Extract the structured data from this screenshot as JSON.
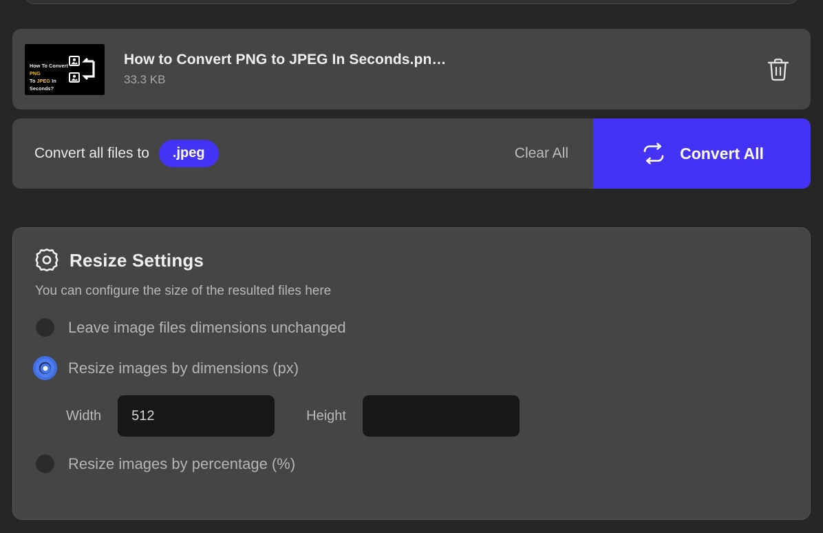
{
  "theme": {
    "page_bg": "#262626",
    "card_bg": "#454545",
    "accent": "#4433f5",
    "radio_accent": "#4472e8",
    "input_bg": "#171717"
  },
  "file_row": {
    "thumbnail": {
      "line1_prefix": "How To Convert ",
      "line1_highlight": "PNG",
      "line2_prefix": "To ",
      "line2_highlight": "JPEG",
      "line2_suffix": " In Seconds?",
      "icon": "image-swap-icon",
      "background": "#000000"
    },
    "name": "How to Convert PNG to JPEG In Seconds.pn…",
    "size": "33.3 KB",
    "delete_icon": "trash-icon"
  },
  "convert_bar": {
    "label": "Convert all files to",
    "format": ".jpeg",
    "clear_all": "Clear All",
    "convert_all": "Convert All",
    "convert_icon": "cycle-arrows-icon"
  },
  "resize_settings": {
    "icon": "gear-icon",
    "title": "Resize Settings",
    "subtitle": "You can configure the size of the resulted files here",
    "options": [
      {
        "label": "Leave image files dimensions unchanged",
        "checked": false
      },
      {
        "label": "Resize images by dimensions (px)",
        "checked": true
      },
      {
        "label": "Resize images by percentage (%)",
        "checked": false
      }
    ],
    "dimensions": {
      "width_label": "Width",
      "width_value": "512",
      "width_placeholder": "",
      "height_label": "Height",
      "height_value": "",
      "height_placeholder": ""
    }
  }
}
